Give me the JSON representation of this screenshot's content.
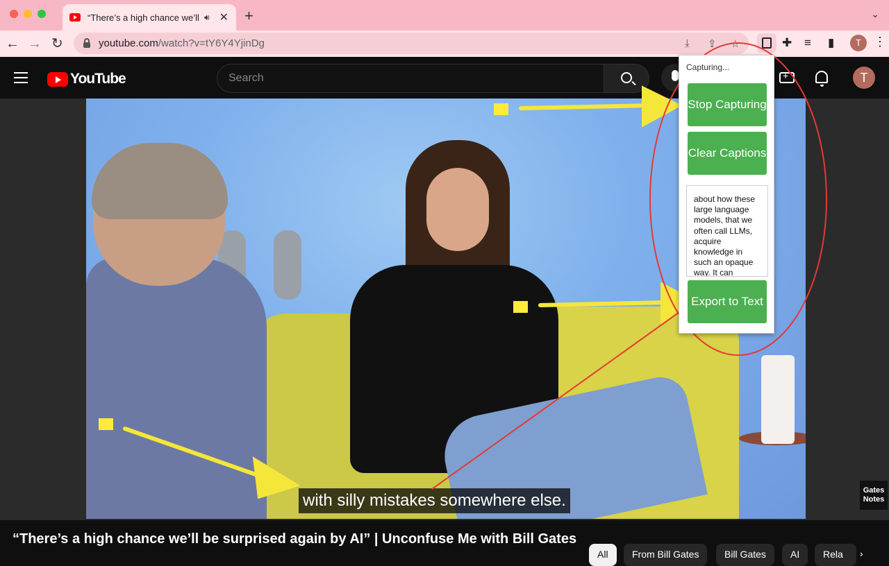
{
  "browser": {
    "tab_title": "“There’s a high chance we’ll be surprised again by AI” | Unconfuse Me with Bill Gates",
    "url_host": "youtube.com",
    "url_path": "/watch?v=tY6Y4YjinDg",
    "profile_initial": "T"
  },
  "youtube": {
    "logo_text": "YouTube",
    "search_placeholder": "Search",
    "avatar_initial": "T"
  },
  "video": {
    "subtitle": "with silly mistakes somewhere else.",
    "watermark": "Gates Notes",
    "title": "“There’s a high chance we’ll be surprised again by AI” | Unconfuse Me with Bill Gates"
  },
  "extension_popup": {
    "status": "Capturing...",
    "stop_button": "Stop Capturing",
    "clear_button": "Clear Captions",
    "export_button": "Export to Text",
    "captured_text": "about how these large language models, that we often call LLMs, acquire knowledge in such an opaque way. It can"
  },
  "chips": [
    "All",
    "From Bill Gates",
    "Bill Gates",
    "AI",
    "Rela"
  ]
}
